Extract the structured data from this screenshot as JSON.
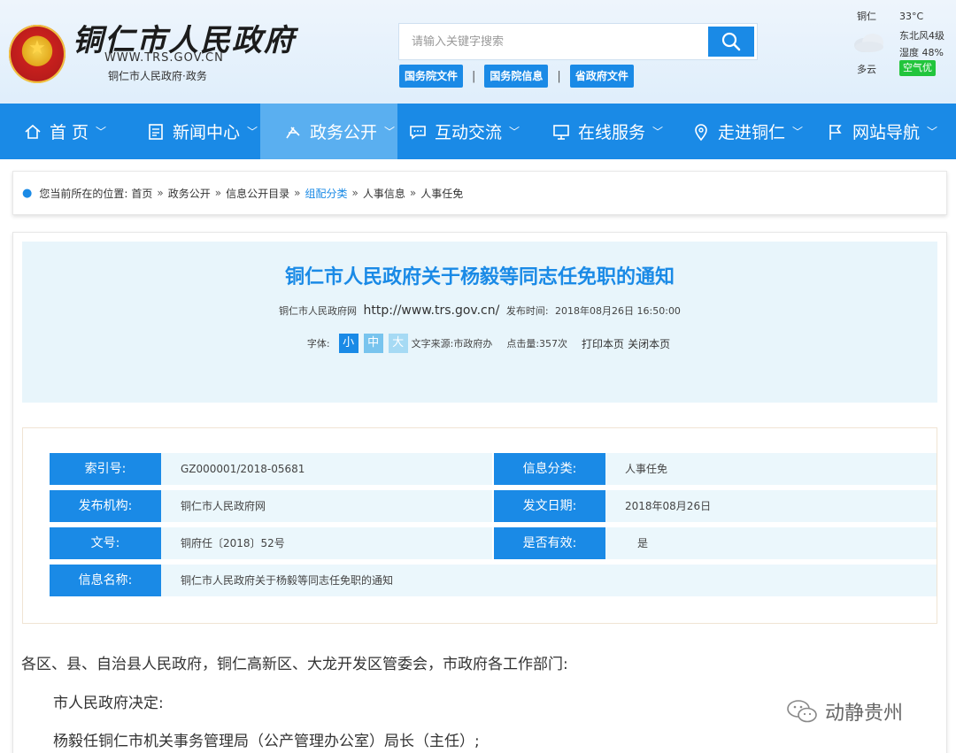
{
  "header": {
    "site_name": "铜仁市人民政府",
    "site_url": "WWW.TRS.GOV.CN",
    "site_sub": "铜仁市人民政府·政务",
    "search_placeholder": "请输入关键字搜索",
    "quick_links": [
      "国务院文件",
      "国务院信息",
      "省政府文件"
    ],
    "weather": {
      "city": "铜仁",
      "temp": "33°C",
      "wind": "东北风4级",
      "humidity": "湿度 48%",
      "desc": "多云",
      "air_quality": "空气优"
    }
  },
  "nav": {
    "items": [
      {
        "label": "首 页",
        "icon": "home-icon"
      },
      {
        "label": "新闻中心",
        "icon": "news-icon"
      },
      {
        "label": "政务公开",
        "icon": "government-icon"
      },
      {
        "label": "互动交流",
        "icon": "chat-icon"
      },
      {
        "label": "在线服务",
        "icon": "monitor-icon"
      },
      {
        "label": "走进铜仁",
        "icon": "location-icon"
      },
      {
        "label": "网站导航",
        "icon": "flag-icon"
      }
    ],
    "active_index": 2
  },
  "breadcrumb": {
    "prefix": "您当前所在的位置:",
    "items": [
      "首页",
      "政务公开",
      "信息公开目录",
      "组配分类",
      "人事信息",
      "人事任免"
    ],
    "separator": "»"
  },
  "document": {
    "title": "铜仁市人民政府关于杨毅等同志任免职的通知",
    "source_site": "铜仁市人民政府网",
    "url": "http://www.trs.gov.cn/",
    "publish_label": "发布时间:",
    "publish_time": "2018年08月26日 16:50:00",
    "font_label": "字体:",
    "font_sizes": [
      "小",
      "中",
      "大"
    ],
    "source_text": "文字来源:市政府办",
    "hits_text": "点击量:357次",
    "print": "打印本页",
    "close": "关闭本页"
  },
  "info": {
    "index_label": "索引号:",
    "index_value": "GZ000001/2018-05681",
    "category_label": "信息分类:",
    "category_value": "人事任免",
    "org_label": "发布机构:",
    "org_value": "铜仁市人民政府网",
    "date_label": "发文日期:",
    "date_value": "2018年08月26日",
    "docno_label": "文号:",
    "docno_value": "铜府任〔2018〕52号",
    "valid_label": "是否有效:",
    "valid_value": "是",
    "name_label": "信息名称:",
    "name_value": "铜仁市人民政府关于杨毅等同志任免职的通知"
  },
  "body": {
    "line1": "各区、县、自治县人民政府，铜仁高新区、大龙开发区管委会，市政府各工作部门:",
    "line2": "市人民政府决定:",
    "line3": "杨毅任铜仁市机关事务管理局（公产管理办公室）局长（主任）;"
  },
  "watermark": "动静贵州",
  "colors": {
    "brand_blue": "#1a8ae6",
    "nav_active": "#5aaff0",
    "title_panel": "#e8f5fb",
    "air_green": "#22c53c"
  }
}
